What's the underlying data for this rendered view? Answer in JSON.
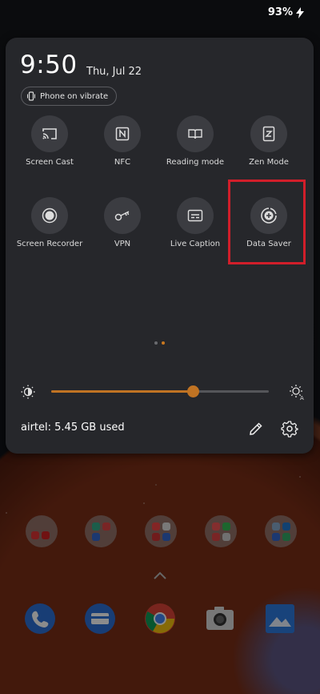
{
  "status_bar": {
    "battery": "93%"
  },
  "quick_settings": {
    "time": "9:50",
    "date": "Thu, Jul 22",
    "ringer_chip": "Phone on vibrate",
    "tiles": [
      {
        "label": "Screen Cast",
        "icon": "screen-cast-icon",
        "active": false
      },
      {
        "label": "NFC",
        "icon": "nfc-icon",
        "active": false
      },
      {
        "label": "Reading mode",
        "icon": "reading-mode-icon",
        "active": false
      },
      {
        "label": "Zen Mode",
        "icon": "zen-mode-icon",
        "active": false
      },
      {
        "label": "Screen Recorder",
        "icon": "screen-recorder-icon",
        "active": false
      },
      {
        "label": "VPN",
        "icon": "vpn-key-icon",
        "active": false
      },
      {
        "label": "Live Caption",
        "icon": "live-caption-icon",
        "active": false
      },
      {
        "label": "Data Saver",
        "icon": "data-saver-icon",
        "active": false
      }
    ],
    "highlighted_tile": "Data Saver",
    "page_indicator": {
      "pages": 2,
      "current": 2
    },
    "brightness": {
      "level": 0.65,
      "auto_icon": "auto-brightness-icon"
    },
    "data_usage": "airtel: 5.45 GB used",
    "accent_color": "#c07323",
    "highlight_color": "#d11e2a"
  },
  "home_screen": {
    "folders": [
      "folder-1",
      "folder-2",
      "folder-3",
      "folder-4",
      "folder-5"
    ],
    "dock": [
      {
        "name": "phone-app",
        "color": "#2d6fd6"
      },
      {
        "name": "messages-app",
        "color": "#2d6fd6"
      },
      {
        "name": "chrome-app",
        "color": "#ffffff"
      },
      {
        "name": "camera-app",
        "color": "#e8e8e8"
      },
      {
        "name": "gallery-app",
        "color": "#2d7be0"
      }
    ]
  }
}
